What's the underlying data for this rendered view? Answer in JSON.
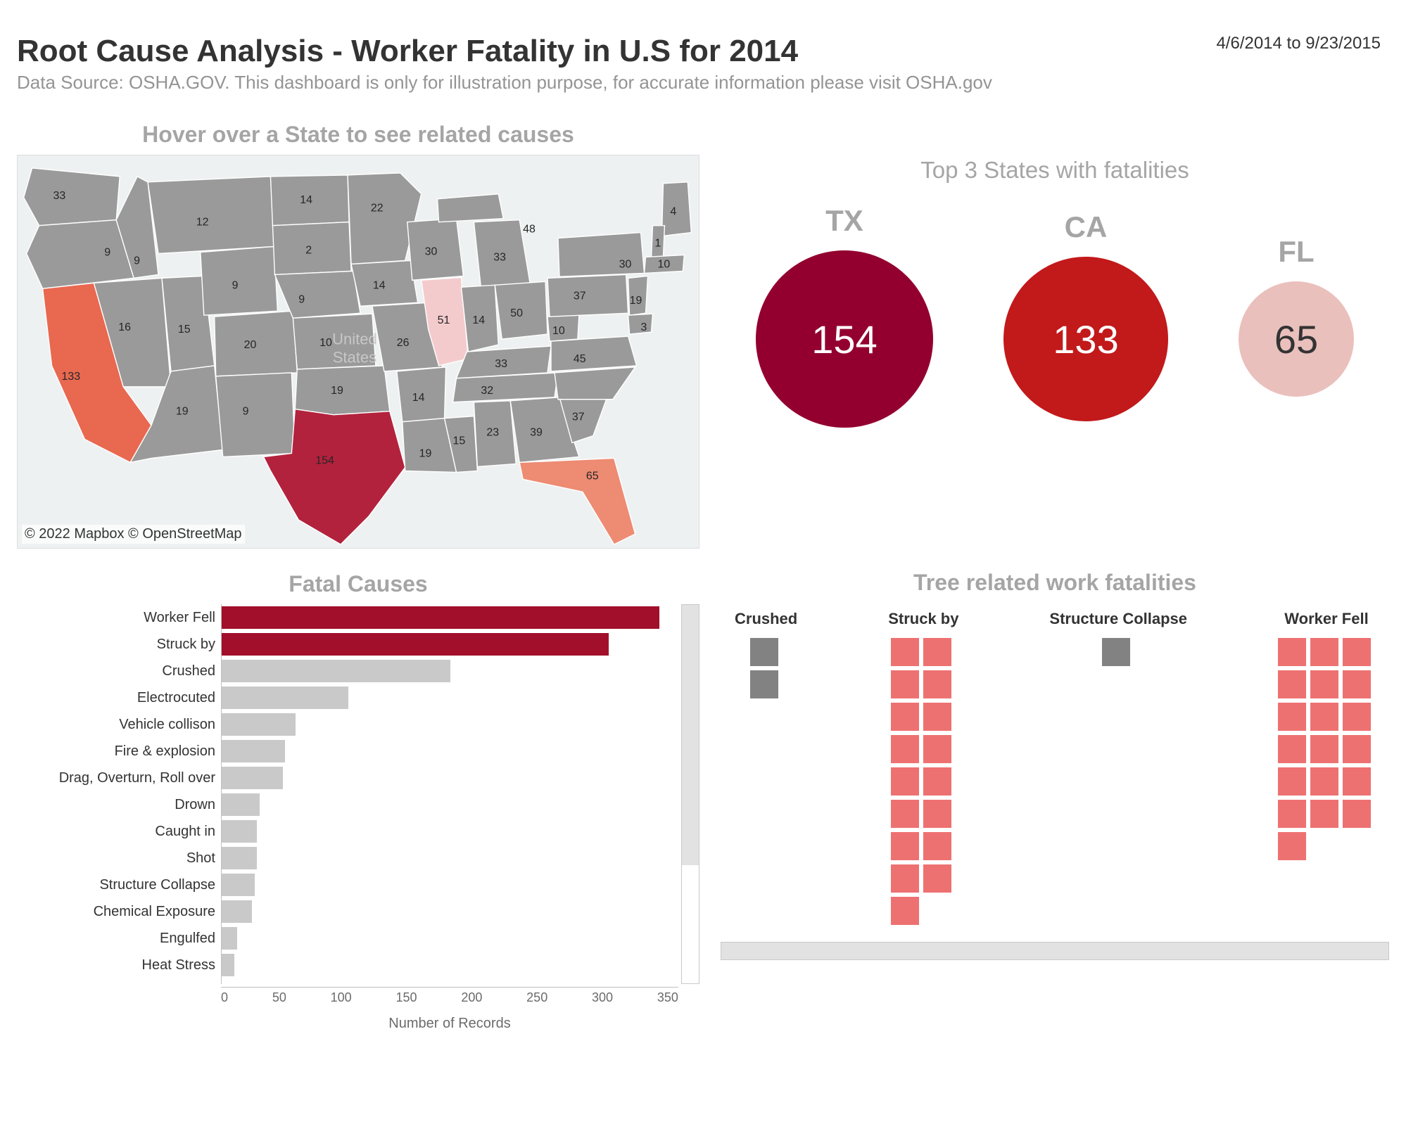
{
  "header": {
    "title": "Root Cause Analysis - Worker Fatality in U.S for 2014",
    "subtitle": "Data Source: OSHA.GOV. This dashboard is only for illustration purpose, for accurate information please visit OSHA.gov",
    "date_range": "4/6/2014 to 9/23/2015"
  },
  "map": {
    "instruction": "Hover over a State to see related causes",
    "watermark": "United\nStates",
    "credit": "© 2022 Mapbox © OpenStreetMap",
    "state_values": {
      "WA": 33,
      "MT": 12,
      "ND": 14,
      "MN": 22,
      "WI": 30,
      "SD": 2,
      "OR": 9,
      "ID": 9,
      "WY": 9,
      "IA": 14,
      "MI": 33,
      "MI-UP": 48,
      "CA": 133,
      "NV": 16,
      "UT": 15,
      "CO": 20,
      "NE": 9,
      "KS": 10,
      "MO": 26,
      "IL": 51,
      "IN": 14,
      "OH": 50,
      "AZ": 19,
      "NM": 9,
      "OK": 19,
      "AR": 14,
      "TN": 32,
      "KY": 33,
      "VA": 45,
      "WV": 10,
      "PA": 37,
      "NY": 30,
      "MD": 3,
      "NJ": 19,
      "TX": 154,
      "LA": 19,
      "MS": 15,
      "AL": 23,
      "GA": 39,
      "SC": 37,
      "FL": 65,
      "ME": 4,
      "NH": 1,
      "MA": 10
    }
  },
  "top_states": {
    "title": "Top 3 States with fatalities",
    "items": [
      {
        "code": "TX",
        "value": 154,
        "color": "#93002f",
        "size": 252,
        "text_color": "#ffffff"
      },
      {
        "code": "CA",
        "value": 133,
        "color": "#c2191b",
        "size": 234,
        "text_color": "#ffffff"
      },
      {
        "code": "FL",
        "value": 65,
        "color": "#eac0bc",
        "size": 164,
        "text_color": "#333333"
      }
    ]
  },
  "fatal_causes": {
    "title": "Fatal Causes",
    "x_label": "Number of Records",
    "x_ticks": [
      "0",
      "50",
      "100",
      "150",
      "200",
      "250",
      "300",
      "350"
    ],
    "x_max": 360,
    "rows": [
      {
        "label": "Worker Fell",
        "value": 345,
        "selected": true
      },
      {
        "label": "Struck by",
        "value": 305,
        "selected": true
      },
      {
        "label": "Crushed",
        "value": 180
      },
      {
        "label": "Electrocuted",
        "value": 100
      },
      {
        "label": "Vehicle collison",
        "value": 58
      },
      {
        "label": "Fire & explosion",
        "value": 50
      },
      {
        "label": "Drag, Overturn, Roll over",
        "value": 48
      },
      {
        "label": "Drown",
        "value": 30
      },
      {
        "label": "Caught in",
        "value": 28
      },
      {
        "label": "Shot",
        "value": 28
      },
      {
        "label": "Structure Collapse",
        "value": 26
      },
      {
        "label": "Chemical Exposure",
        "value": 24
      },
      {
        "label": "Engulfed",
        "value": 12
      },
      {
        "label": "Heat Stress",
        "value": 10
      }
    ]
  },
  "tree": {
    "title": "Tree related work fatalities",
    "cols": [
      {
        "label": "Crushed",
        "count": 2,
        "wide": 1,
        "gray": true
      },
      {
        "label": "Struck by",
        "count": 17,
        "wide": 2,
        "gray": false
      },
      {
        "label": "Structure Collapse",
        "count": 1,
        "wide": 1,
        "gray": true
      },
      {
        "label": "Worker Fell",
        "count": 19,
        "wide": 3,
        "gray": false
      }
    ]
  },
  "chart_data": [
    {
      "type": "bar",
      "title": "Fatal Causes",
      "xlabel": "Number of Records",
      "ylabel": "",
      "categories": [
        "Worker Fell",
        "Struck by",
        "Crushed",
        "Electrocuted",
        "Vehicle collison",
        "Fire & explosion",
        "Drag, Overturn, Roll over",
        "Drown",
        "Caught in",
        "Shot",
        "Structure Collapse",
        "Chemical Exposure",
        "Engulfed",
        "Heat Stress"
      ],
      "values": [
        345,
        305,
        180,
        100,
        58,
        50,
        48,
        30,
        28,
        28,
        26,
        24,
        12,
        10
      ],
      "highlighted": [
        "Worker Fell",
        "Struck by"
      ],
      "xlim": [
        0,
        350
      ]
    },
    {
      "type": "bar",
      "title": "Top 3 States with fatalities",
      "categories": [
        "TX",
        "CA",
        "FL"
      ],
      "values": [
        154,
        133,
        65
      ]
    },
    {
      "type": "bar",
      "title": "Tree related work fatalities",
      "categories": [
        "Crushed",
        "Struck by",
        "Structure Collapse",
        "Worker Fell"
      ],
      "values": [
        2,
        17,
        1,
        19
      ]
    }
  ]
}
